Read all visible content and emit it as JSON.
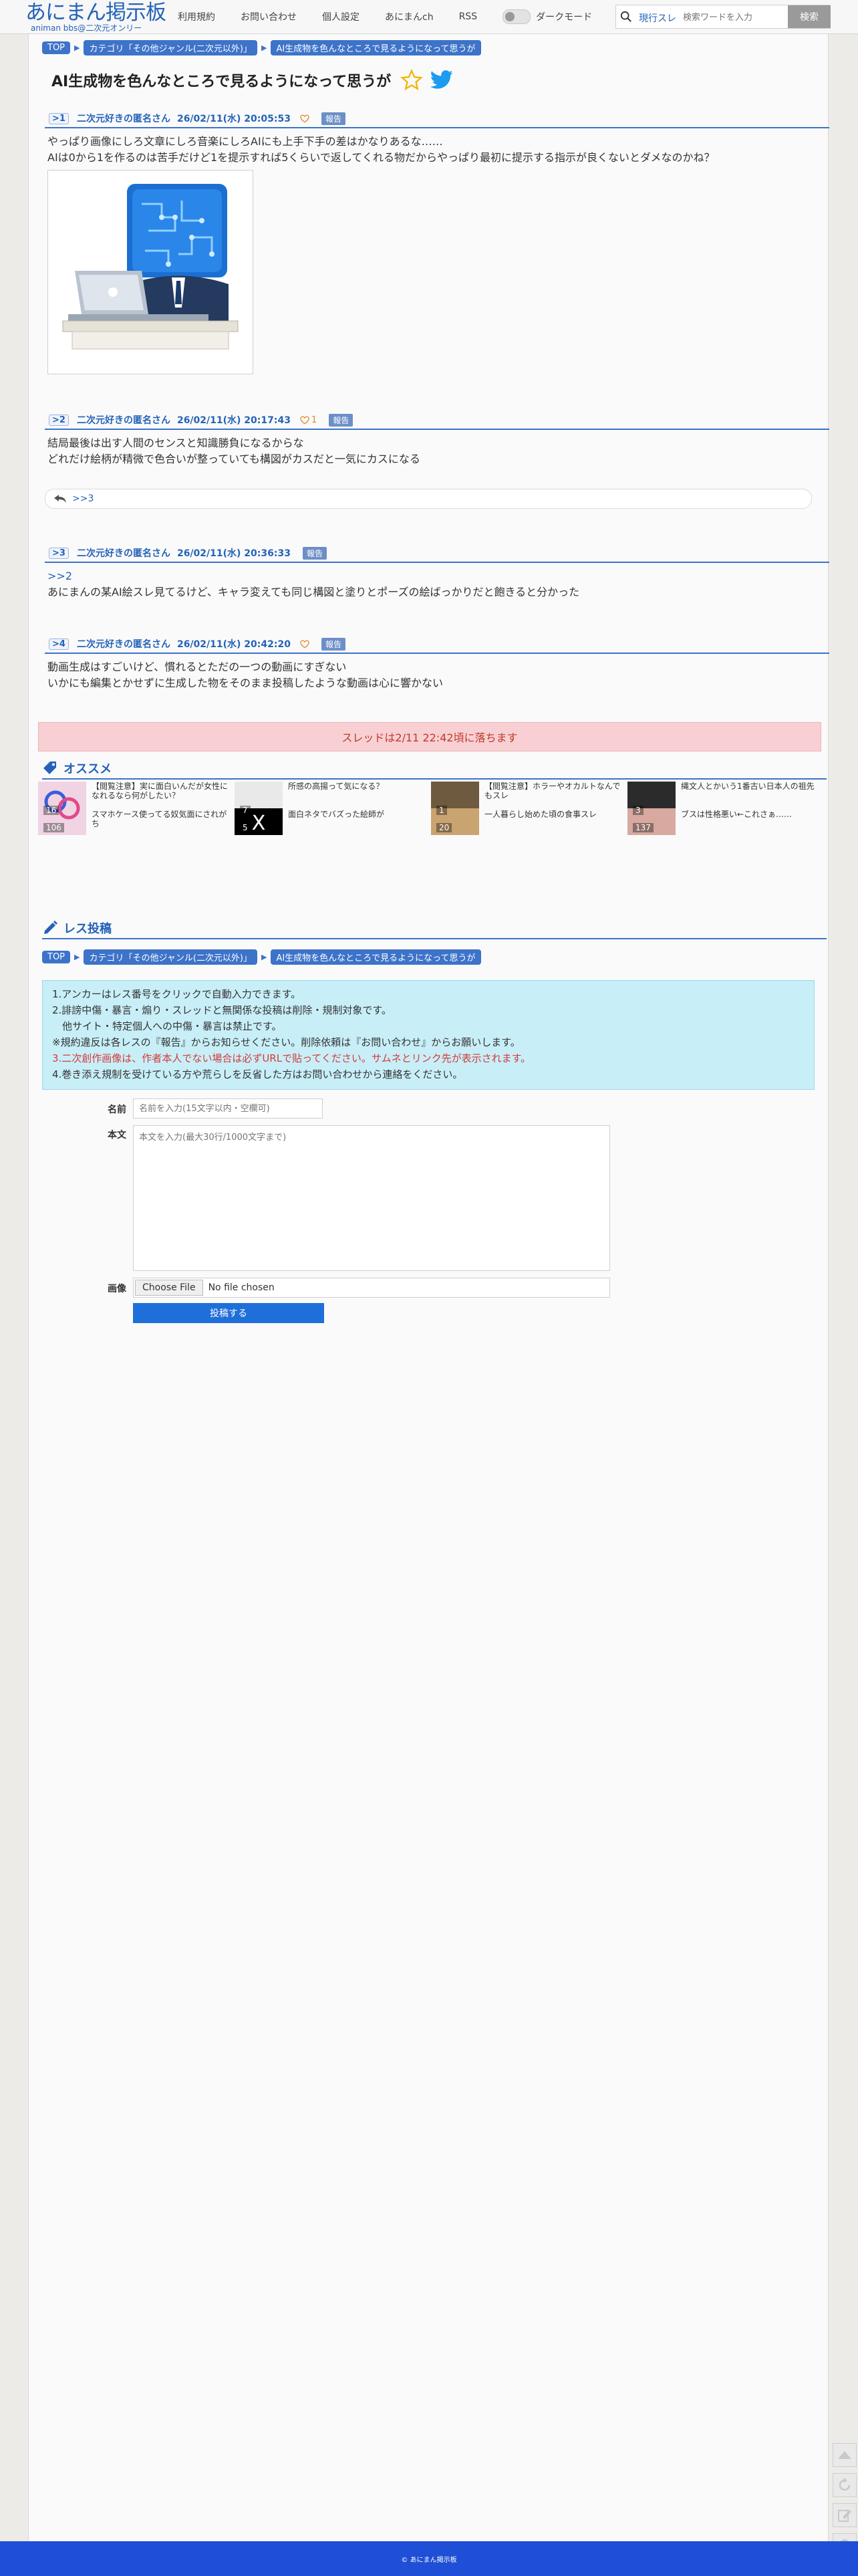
{
  "header": {
    "logo_title": "あにまん掲示板",
    "logo_sub": "animan bbs@二次元オンリー",
    "nav": [
      "利用規約",
      "お問い合わせ",
      "個人設定",
      "あにまんch",
      "RSS"
    ],
    "dark_mode_label": "ダークモード",
    "trend_link": "現行スレ",
    "search_placeholder": "検索ワードを入力",
    "search_button": "検索"
  },
  "breadcrumb": [
    "TOP",
    "カテゴリ「その他ジャンル(二次元以外)」",
    "AI生成物を色んなところで見るようになって思うが"
  ],
  "thread_title": "AI生成物を色んなところで見るようになって思うが",
  "posts": [
    {
      "num": ">1",
      "name": "二次元好きの匿名さん",
      "date": "26/02/11(水) 20:05:53",
      "likes": "",
      "report": "報告",
      "lines": [
        "やっぱり画像にしろ文章にしろ音楽にしろAIにも上手下手の差はかなりあるな……",
        "AIは0から1を作るのは苦手だけど1を提示すれば5くらいで返してくれる物だからやっぱり最初に提示する指示が良くないとダメなのかね？"
      ]
    },
    {
      "num": ">2",
      "name": "二次元好きの匿名さん",
      "date": "26/02/11(水) 20:17:43",
      "likes": "1",
      "report": "報告",
      "lines": [
        "結局最後は出す人間のセンスと知識勝負になるからな",
        "どれだけ絵柄が精微で色合いが整っていても構図がカスだと一気にカスになる"
      ],
      "reply": ">>3"
    },
    {
      "num": ">3",
      "name": "二次元好きの匿名さん",
      "date": "26/02/11(水) 20:36:33",
      "likes": "",
      "report": "報告",
      "anchor": ">>2",
      "lines": [
        "あにまんの某AI絵スレ見てるけど、キャラ変えても同じ構図と塗りとポーズの絵ばっかりだと飽きると分かった"
      ]
    },
    {
      "num": ">4",
      "name": "二次元好きの匿名さん",
      "date": "26/02/11(水) 20:42:20",
      "likes": "",
      "report": "報告",
      "lines": [
        "動画生成はすごいけど、慣れるとただの一つの動画にすぎない",
        "いかにも編集とかせずに生成した物をそのまま投稿したような動画は心に響かない"
      ]
    }
  ],
  "expire_notice": "スレッドは2/11 22:42頃に落ちます",
  "recommend": {
    "heading": "オススメ",
    "items": [
      {
        "title": "【閲覧注意】実に面白いんだが女性になれるなら何がしたい？",
        "count": "16",
        "title2": "スマホケース使ってる奴気面にされがち",
        "count2": "106"
      },
      {
        "title": "所感の高揚って気になる？",
        "count": "7",
        "title2": "面白ネタでバズった絵師が",
        "count2": "5"
      },
      {
        "title": "【閲覧注意】ホラーやオカルトなんでもスレ",
        "count": "1",
        "title2": "一人暮らし始めた頃の食事スレ",
        "count2": "20"
      },
      {
        "title": "縄文人とかいう1番古い日本人の祖先",
        "count": "3",
        "title2": "ブスは性格悪い←これさぁ……",
        "count2": "137"
      }
    ]
  },
  "post_form": {
    "heading": "レス投稿",
    "rules": [
      "1.アンカーはレス番号をクリックで自動入力できます。",
      "2.誹謗中傷・暴言・煽り・スレッドと無関係な投稿は削除・規制対象です。",
      "　他サイト・特定個人への中傷・暴言は禁止です。",
      "※規約違反は各レスの『報告』からお知らせください。削除依頼は『お問い合わせ』からお願いします。",
      "3.二次創作画像は、作者本人でない場合は必ずURLで貼ってください。サムネとリンク先が表示されます。",
      "4.巻き添え規制を受けている方や荒らしを反省した方はお問い合わせから連絡をください。"
    ],
    "name_label": "名前",
    "name_placeholder": "名前を入力(15文字以内・空欄可)",
    "body_label": "本文",
    "body_placeholder": "本文を入力(最大30行/1000文字まで)",
    "image_label": "画像",
    "file_button": "Choose File",
    "file_status": "No file chosen",
    "submit": "投稿する"
  },
  "footer": "© あにまん掲示板",
  "colors": {
    "accent": "#3d73c9",
    "footer": "#1f4fd6",
    "notice_bg": "#f8d0d3",
    "rules_bg": "#c8eff8"
  }
}
